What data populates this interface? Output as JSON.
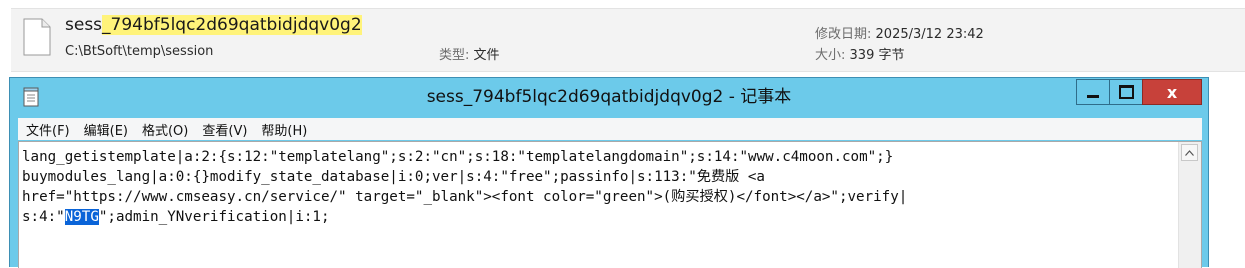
{
  "search_result": {
    "file_name": {
      "prefix": "sess",
      "highlighted": "_794bf5lqc2d69qatbidjdqv0g2"
    },
    "path": "C:\\BtSoft\\temp\\session",
    "type_label": "类型:",
    "type_value": "文件",
    "modified_label": "修改日期:",
    "modified_value": "2025/3/12 23:42",
    "size_label": "大小:",
    "size_value": "339 字节",
    "highlight_color": "#fff37a"
  },
  "notepad": {
    "title": "sess_794bf5lqc2d69qatbidjdqv0g2 - 记事本",
    "controls": {
      "close": "x"
    },
    "menu": [
      "文件(F)",
      "编辑(E)",
      "格式(O)",
      "查看(V)",
      "帮助(H)"
    ],
    "content": {
      "line1": "lang_getistemplate|a:2:{s:12:\"templatelang\";s:2:\"cn\";s:18:\"templatelangdomain\";s:14:\"www.c4moon.com\";}",
      "line2": "buymodules_lang|a:0:{}modify_state_database|i:0;ver|s:4:\"free\";passinfo|s:113:\"免费版 <a",
      "line3": "href=\"https://www.cmseasy.cn/service/\" target=\"_blank\"><font color=\"green\">(购买授权)</font></a>\";verify|",
      "line4_before": "s:4:\"",
      "line4_selected": "N9TG",
      "line4_after": "\";admin_YNverification|i:1;"
    },
    "colors": {
      "titlebar": "#6ccaea",
      "close_button": "#c7413a",
      "selection": "#0a64d8"
    }
  },
  "icons": [
    "file-icon",
    "notepad-icon",
    "minimize-icon",
    "maximize-icon",
    "close-icon",
    "scroll-up-arrow-icon"
  ]
}
